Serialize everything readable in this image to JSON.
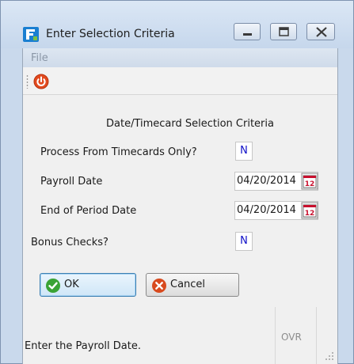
{
  "window": {
    "title": "Enter Selection Criteria"
  },
  "menu": {
    "file": "File"
  },
  "form": {
    "section_title": "Date/Timecard Selection Criteria",
    "process_from_timecards_label": "Process From Timecards Only?",
    "process_from_timecards_value": "N",
    "payroll_date_label": "Payroll Date",
    "payroll_date_value": "04/20/2014",
    "end_of_period_label": "End of Period Date",
    "end_of_period_value": "04/20/2014",
    "bonus_checks_label": "Bonus Checks?",
    "bonus_checks_value": "N"
  },
  "buttons": {
    "ok": "OK",
    "cancel": "Cancel"
  },
  "status": {
    "message": "Enter the Payroll Date.",
    "mode": "OVR"
  },
  "colors": {
    "title_bar": "#c6d7ec",
    "client_bg": "#f0f0f0",
    "yn_value": "#1010c8",
    "power_icon": "#e0401c"
  },
  "icons": {
    "app": "app-logo-icon",
    "power": "power-icon",
    "calendar": "calendar-icon",
    "ok": "checkmark-icon",
    "cancel": "cancel-x-icon"
  }
}
